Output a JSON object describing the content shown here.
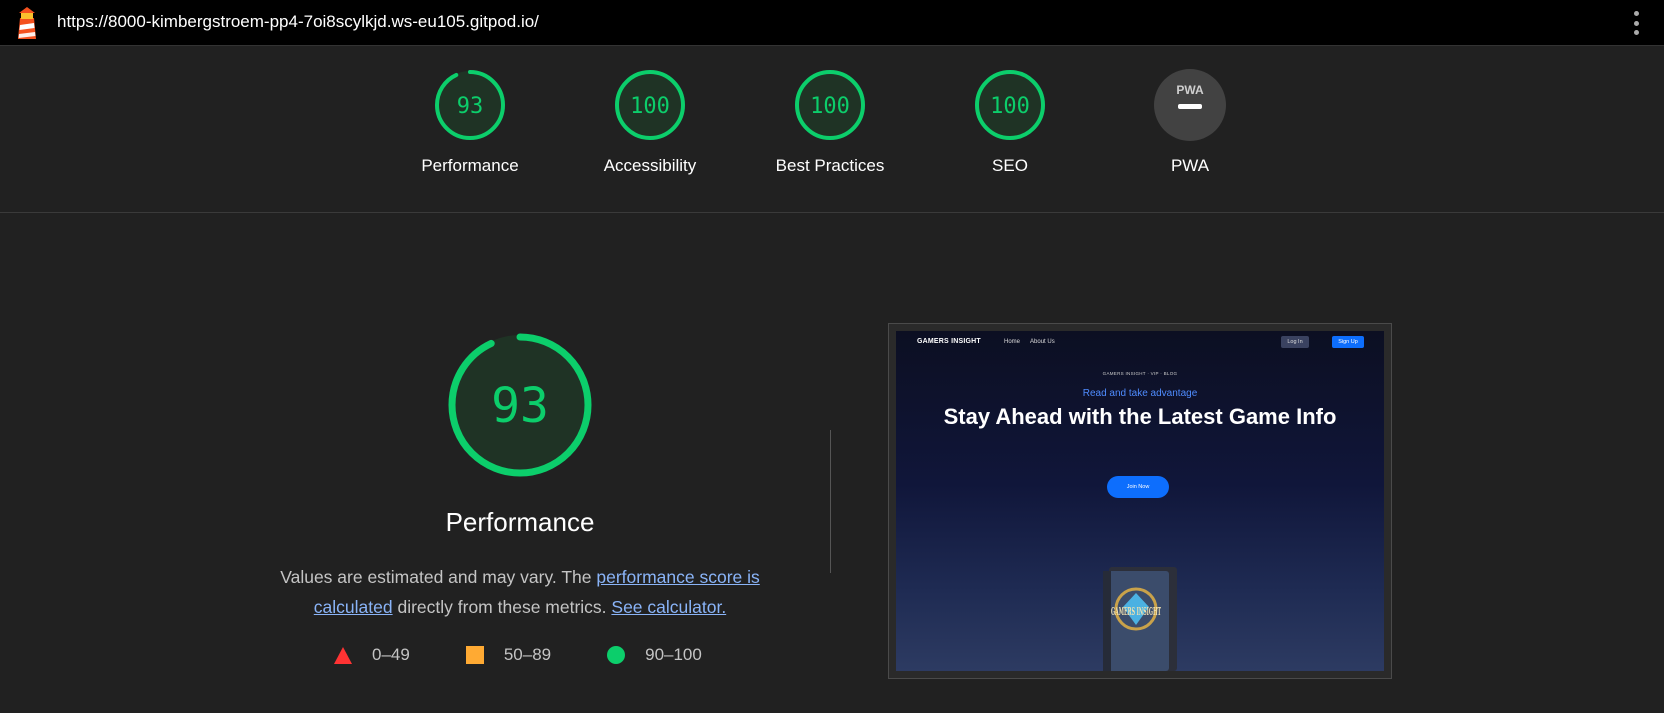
{
  "browser": {
    "url": "https://8000-kimbergstroem-pp4-7oi8scylkjd.ws-eu105.gitpod.io/",
    "logo_icon": "lighthouse-icon",
    "menu_icon": "kebab-menu-icon"
  },
  "categories": [
    {
      "label": "Performance",
      "score": "93",
      "fraction": 0.93
    },
    {
      "label": "Accessibility",
      "score": "100",
      "fraction": 1.0
    },
    {
      "label": "Best Practices",
      "score": "100",
      "fraction": 1.0
    },
    {
      "label": "SEO",
      "score": "100",
      "fraction": 1.0
    },
    {
      "label": "PWA",
      "score": "",
      "badge_text": "PWA",
      "state": "not-applicable"
    }
  ],
  "colors": {
    "pass": "#0cce6b",
    "average": "#ffaa33",
    "fail": "#ff3333",
    "link": "#8ab4f8",
    "background": "#212121"
  },
  "performance": {
    "score": "93",
    "fraction": 0.93,
    "title": "Performance",
    "desc_pre": "Values are estimated and may vary. The ",
    "link1": "performance score is calculated",
    "desc_mid": " directly from these metrics. ",
    "link2": "See calculator."
  },
  "legend": [
    {
      "range": "0–49",
      "symbol": "triangle"
    },
    {
      "range": "50–89",
      "symbol": "square"
    },
    {
      "range": "90–100",
      "symbol": "circle"
    }
  ],
  "screenshot": {
    "brand": "GAMERS INSIGHT",
    "nav": [
      "Home",
      "About Us"
    ],
    "login": "Log In",
    "signup": "Sign Up",
    "tagline": "GAMERS INSIGHT · VIP · BLOG",
    "subheading": "Read and take advantage",
    "heading": "Stay Ahead with the Latest Game Info",
    "cta": "Join Now",
    "book_text": "GAMERS INSIGHT"
  }
}
